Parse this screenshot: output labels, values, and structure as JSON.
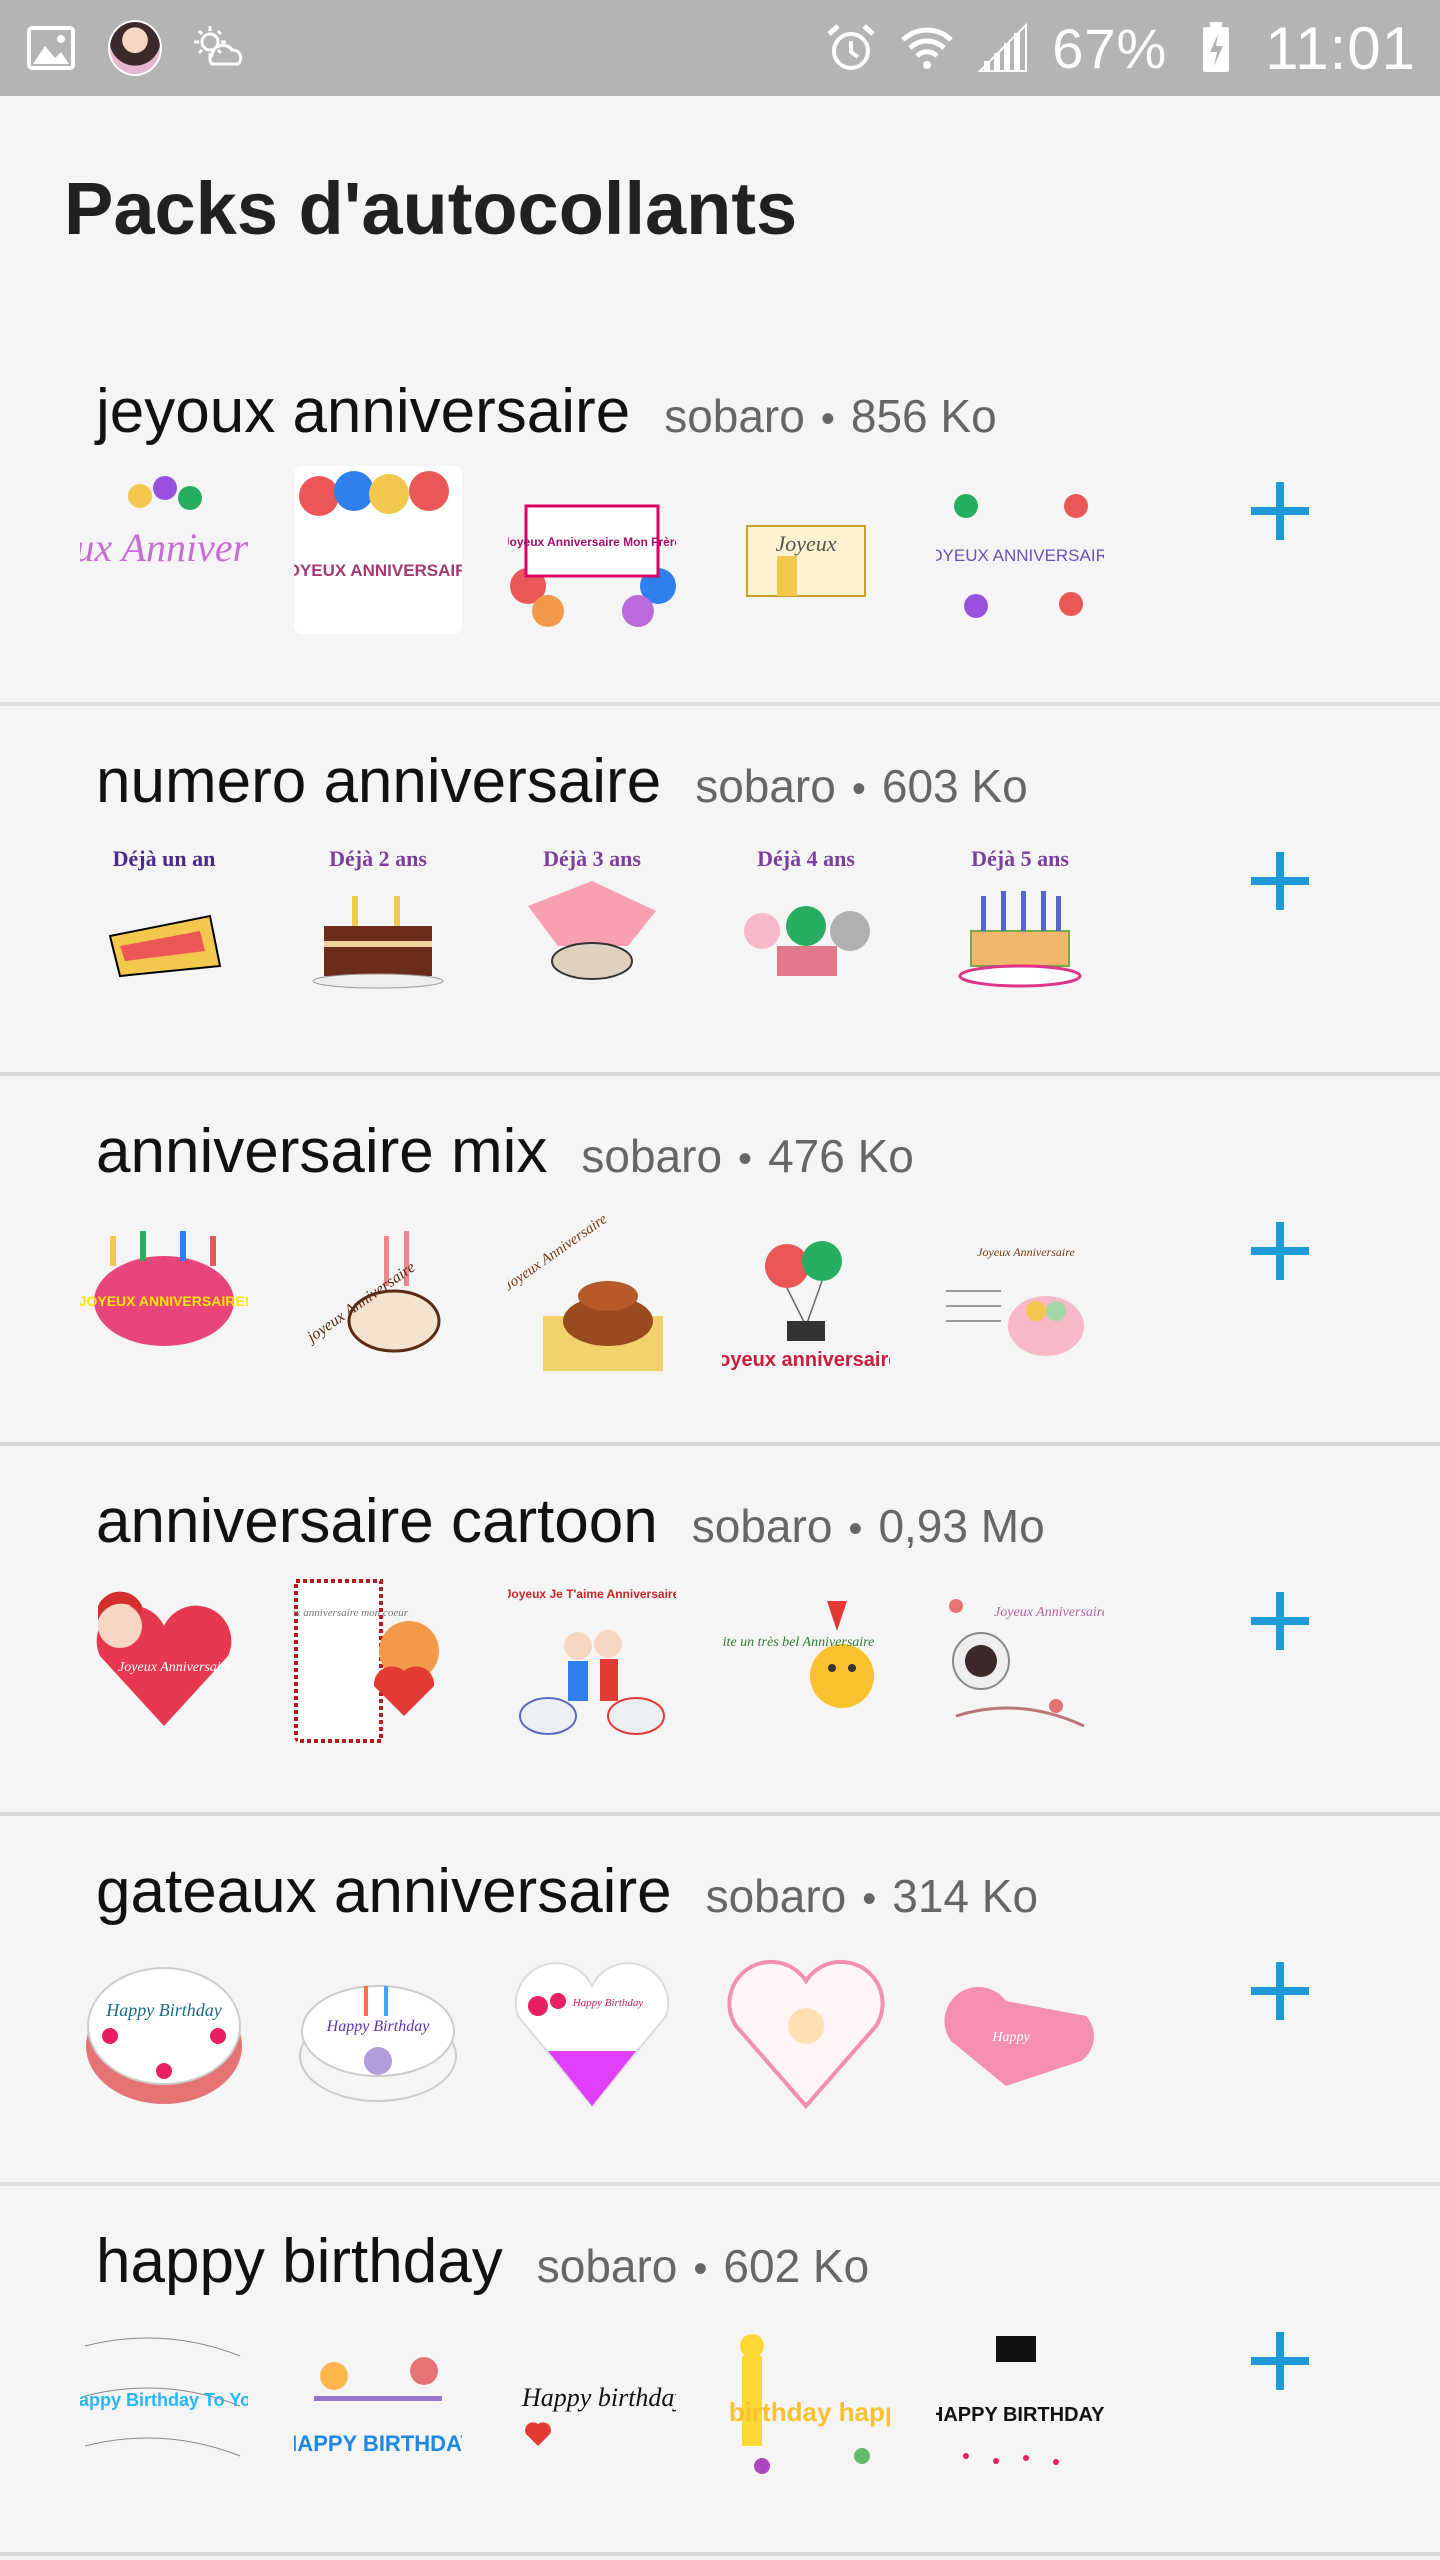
{
  "status_bar": {
    "battery": "67%",
    "time": "11:01",
    "icons": [
      "gallery-icon",
      "avatar-icon",
      "weather-icon",
      "alarm-icon",
      "wifi-icon",
      "signal-icon",
      "battery-icon"
    ]
  },
  "header": {
    "title": "Packs d'autocollants"
  },
  "colors": {
    "accent": "#1e9ad6",
    "status_bar": "#b4b4b4",
    "background": "#f5f5f5"
  },
  "packs": [
    {
      "name": "jeyoux anniversaire",
      "author": "sobaro",
      "size": "856 Ko",
      "stickers": [
        {
          "text": "Joyeux Anniversaire"
        },
        {
          "text": "JOYEUX ANNIVERSAIRE"
        },
        {
          "text": "Joyeux Anniversaire Mon Frère"
        },
        {
          "text": "Joyeux"
        },
        {
          "text": "JOYEUX ANNIVERSAIRE"
        }
      ]
    },
    {
      "name": "numero anniversaire",
      "author": "sobaro",
      "size": "603 Ko",
      "stickers": [
        {
          "text": "Déjà un an"
        },
        {
          "text": "Déjà 2 ans"
        },
        {
          "text": "Déjà 3 ans"
        },
        {
          "text": "Déjà 4 ans"
        },
        {
          "text": "Déjà 5 ans"
        }
      ]
    },
    {
      "name": "anniversaire mix",
      "author": "sobaro",
      "size": "476 Ko",
      "stickers": [
        {
          "text": "JOYEUX ANNIVERSAIRE!"
        },
        {
          "text": "joyeux Anniversaire"
        },
        {
          "text": "Joyeux Anniversaire"
        },
        {
          "text": "joyeux anniversaire"
        },
        {
          "text": "Joyeux Anniversaire"
        }
      ]
    },
    {
      "name": "anniversaire cartoon",
      "author": "sobaro",
      "size": "0,93 Mo",
      "stickers": [
        {
          "text": "Joyeux Anniversaire"
        },
        {
          "text": "Joyeux anniversaire mon coeur"
        },
        {
          "text": "Joyeux Je T'aime Anniversaire"
        },
        {
          "text": "Je te souhaite un très bel Anniversaire"
        },
        {
          "text": "Joyeux Anniversaire"
        }
      ]
    },
    {
      "name": "gateaux anniversaire",
      "author": "sobaro",
      "size": "314 Ko",
      "stickers": [
        {
          "text": "Happy Birthday"
        },
        {
          "text": "Happy Birthday"
        },
        {
          "text": "Happy Birthday"
        },
        {
          "text": ""
        },
        {
          "text": "Happy"
        }
      ]
    },
    {
      "name": "happy birthday",
      "author": "sobaro",
      "size": "602 Ko",
      "stickers": [
        {
          "text": "Happy Birthday To You"
        },
        {
          "text": "HAPPY BIRTHDAY"
        },
        {
          "text": "Happy birthday"
        },
        {
          "text": "birthday happy"
        },
        {
          "text": "HAPPY BIRTHDAY!"
        }
      ]
    }
  ]
}
